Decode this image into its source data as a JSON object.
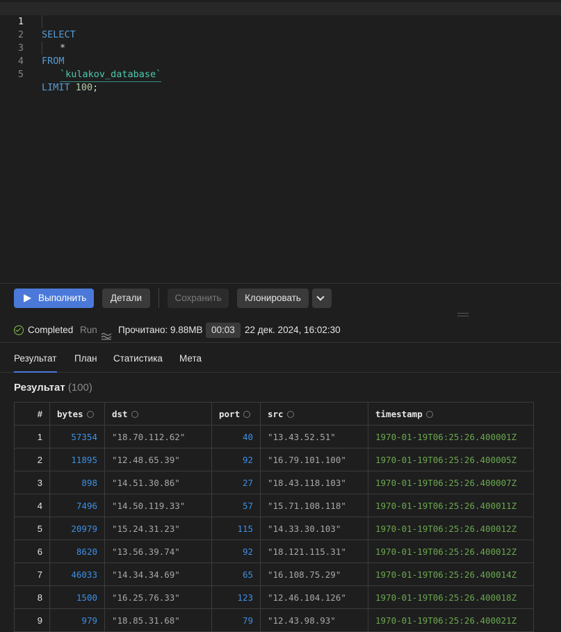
{
  "editor": {
    "lines": [
      {
        "num": "1",
        "text": "SELECT"
      },
      {
        "num": "2",
        "text": "*"
      },
      {
        "num": "3",
        "text": "FROM"
      },
      {
        "num": "4",
        "text": "`kulakov_database`"
      },
      {
        "num": "5",
        "keyword": "LIMIT",
        "number": "100",
        "end": ";"
      }
    ]
  },
  "toolbar": {
    "run_label": "Выполнить",
    "details_label": "Детали",
    "save_label": "Сохранить",
    "clone_label": "Клонировать"
  },
  "status": {
    "state": "Completed",
    "mode": "Run",
    "read": "Прочитано: 9.88MB",
    "duration": "00:03",
    "datetime": "22 дек. 2024, 16:02:30"
  },
  "tabs": [
    "Результат",
    "План",
    "Статистика",
    "Мета"
  ],
  "result": {
    "title": "Результат",
    "count": "(100)",
    "columns": [
      "#",
      "bytes",
      "dst",
      "port",
      "src",
      "timestamp"
    ],
    "rows": [
      [
        "1",
        "57354",
        "\"18.70.112.62\"",
        "40",
        "\"13.43.52.51\"",
        "1970-01-19T06:25:26.400001Z"
      ],
      [
        "2",
        "11895",
        "\"12.48.65.39\"",
        "92",
        "\"16.79.101.100\"",
        "1970-01-19T06:25:26.400005Z"
      ],
      [
        "3",
        "898",
        "\"14.51.30.86\"",
        "27",
        "\"18.43.118.103\"",
        "1970-01-19T06:25:26.400007Z"
      ],
      [
        "4",
        "7496",
        "\"14.50.119.33\"",
        "57",
        "\"15.71.108.118\"",
        "1970-01-19T06:25:26.400011Z"
      ],
      [
        "5",
        "20979",
        "\"15.24.31.23\"",
        "115",
        "\"14.33.30.103\"",
        "1970-01-19T06:25:26.400012Z"
      ],
      [
        "6",
        "8620",
        "\"13.56.39.74\"",
        "92",
        "\"18.121.115.31\"",
        "1970-01-19T06:25:26.400012Z"
      ],
      [
        "7",
        "46033",
        "\"14.34.34.69\"",
        "65",
        "\"16.108.75.29\"",
        "1970-01-19T06:25:26.400014Z"
      ],
      [
        "8",
        "1500",
        "\"16.25.76.33\"",
        "123",
        "\"12.46.104.126\"",
        "1970-01-19T06:25:26.400018Z"
      ],
      [
        "9",
        "979",
        "\"18.85.31.68\"",
        "79",
        "\"12.43.98.93\"",
        "1970-01-19T06:25:26.400021Z"
      ]
    ]
  }
}
